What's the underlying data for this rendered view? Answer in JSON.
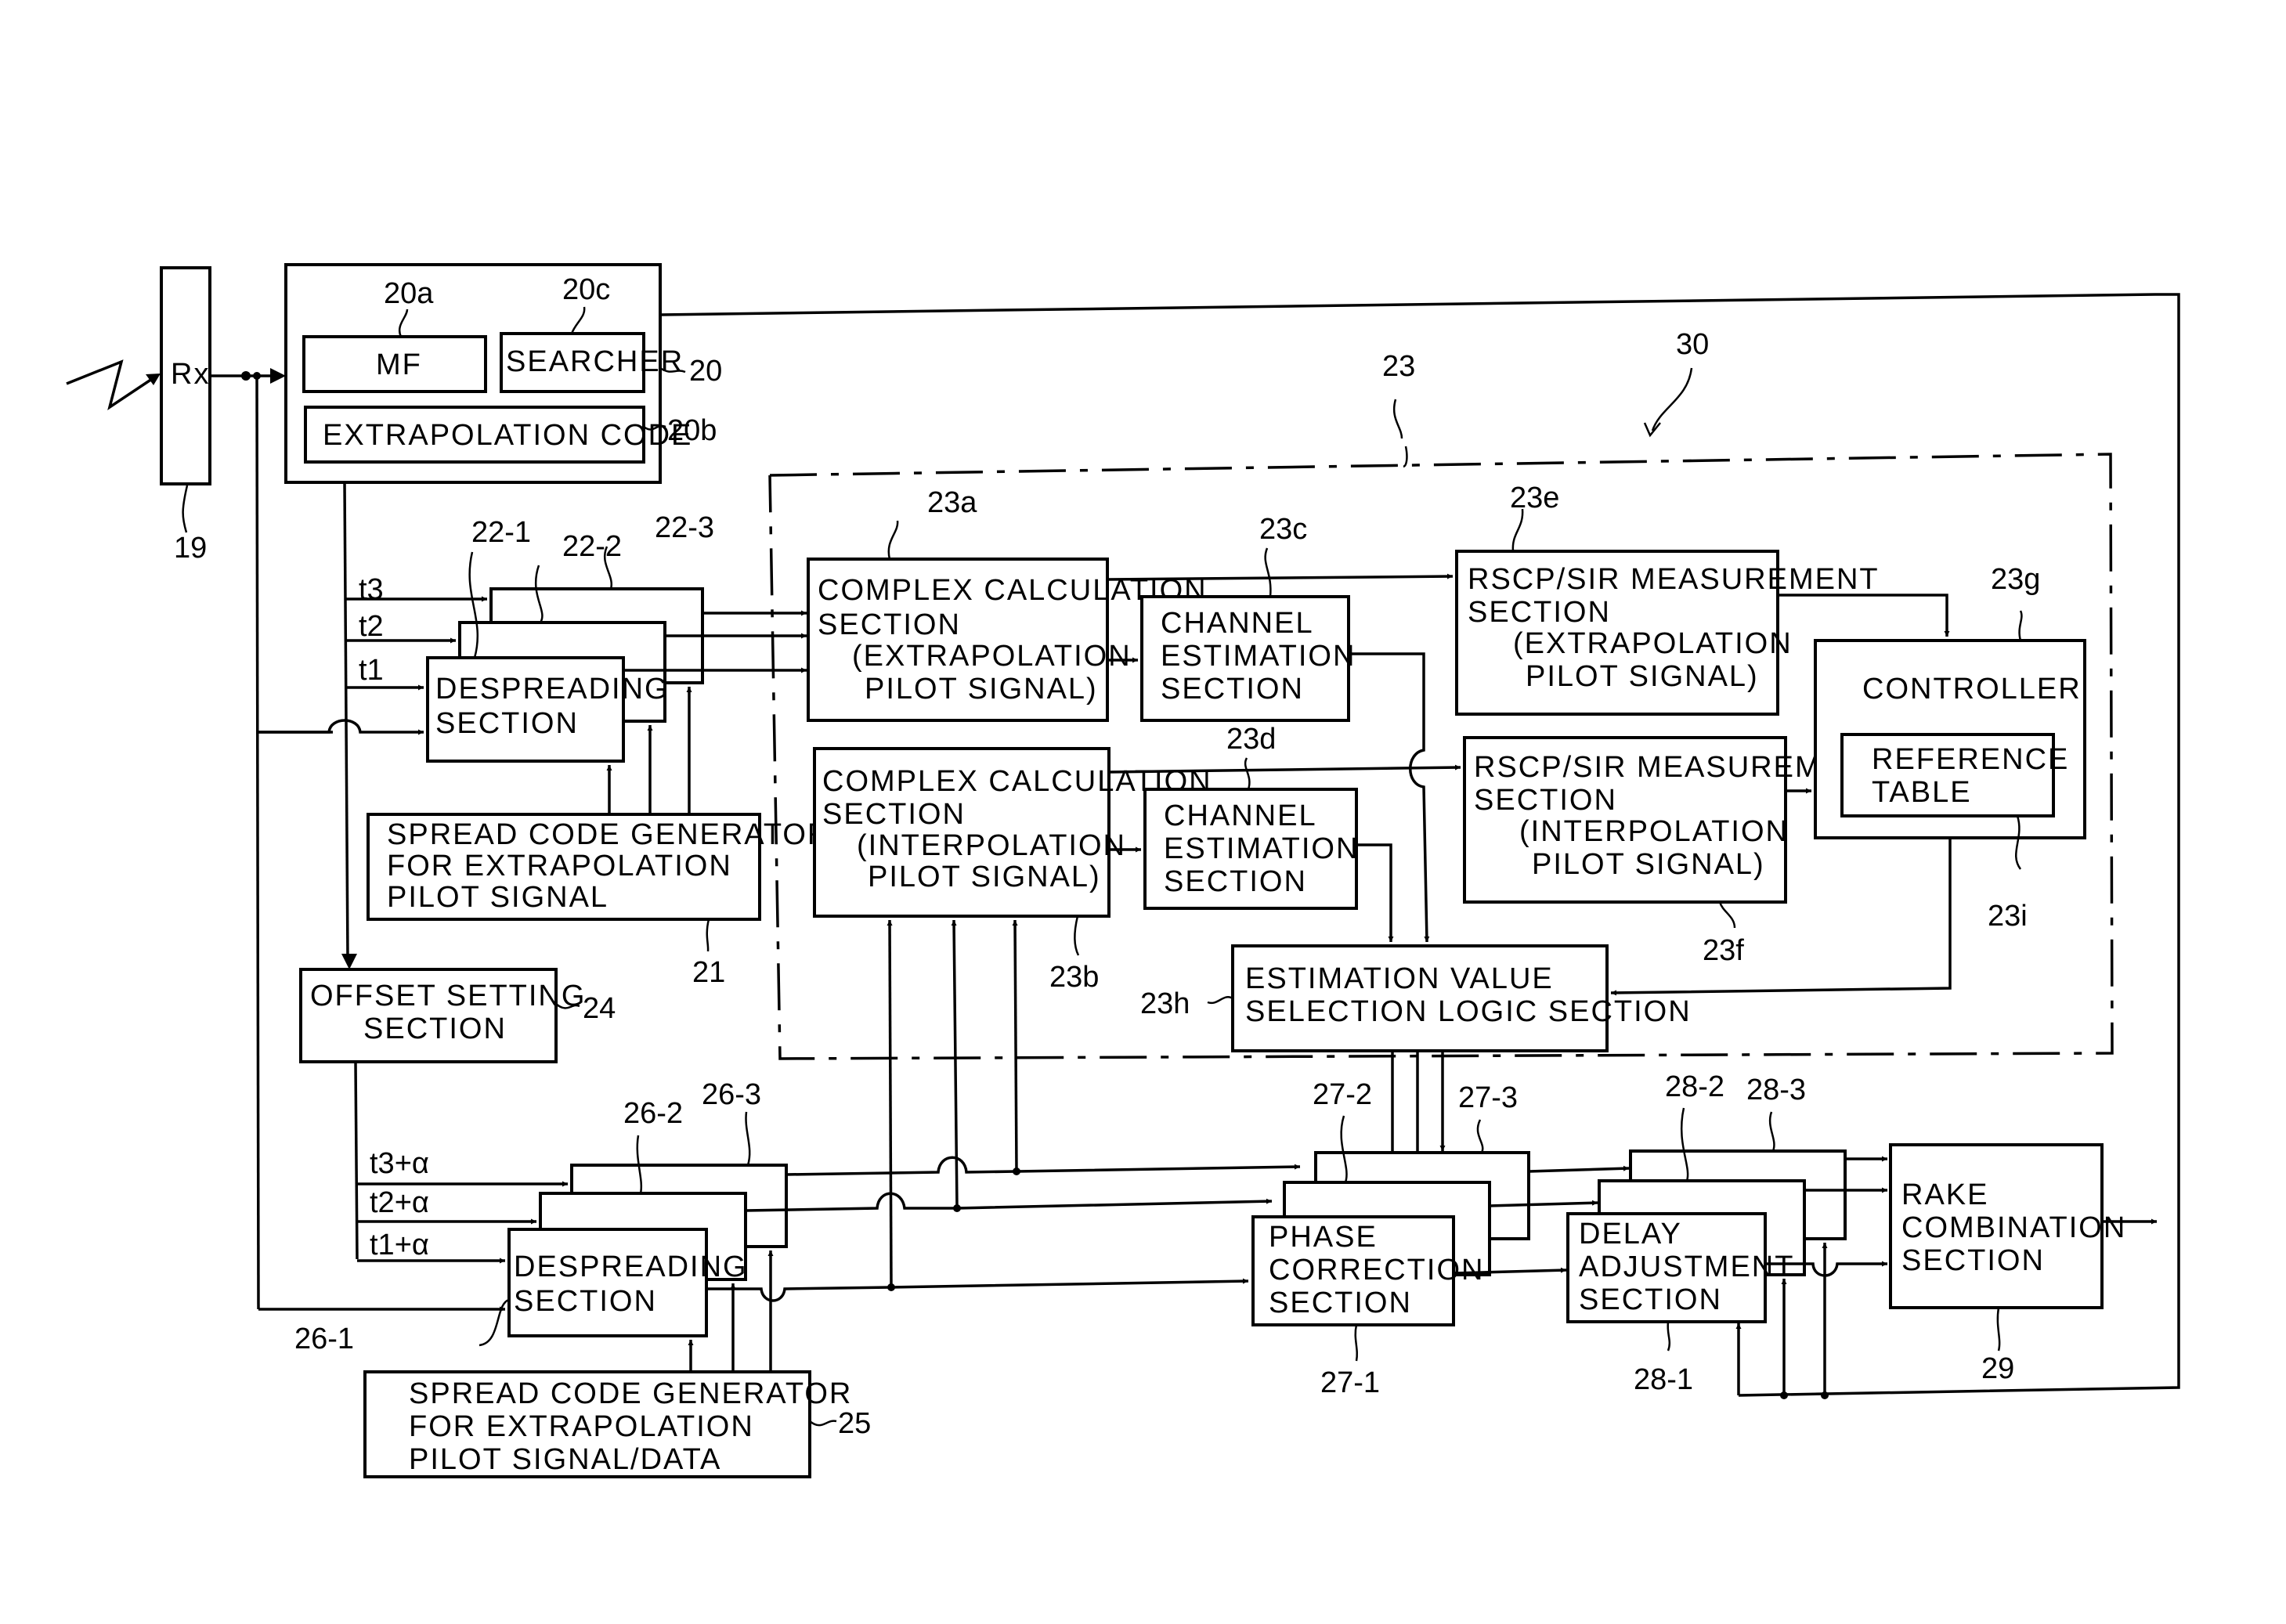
{
  "figure": {
    "system_ref": "30",
    "blocks": {
      "rx": {
        "label": "Rx",
        "ref": "19"
      },
      "block20": {
        "ref": "20"
      },
      "mf": {
        "label": "MF",
        "ref": "20a"
      },
      "searcher": {
        "label": "SEARCHER",
        "ref": "20c"
      },
      "extrapolation_code": {
        "label": "EXTRAPOLATION CODE",
        "ref": "20b"
      },
      "despreading_22": {
        "lines": [
          "DESPREADING",
          "SECTION"
        ],
        "refs": [
          "22-1",
          "22-2",
          "22-3"
        ]
      },
      "spread_code_gen_21": {
        "lines": [
          "SPREAD CODE GENERATOR",
          "FOR EXTRAPOLATION",
          "PILOT SIGNAL"
        ],
        "ref": "21"
      },
      "offset_setting": {
        "lines": [
          "OFFSET SETTING",
          "SECTION"
        ],
        "ref": "24"
      },
      "group23": {
        "ref": "23"
      },
      "complex_calc_extra": {
        "lines": [
          "COMPLEX CALCULATION",
          "SECTION",
          "(EXTRAPOLATION",
          "PILOT SIGNAL)"
        ],
        "ref": "23a"
      },
      "complex_calc_inter": {
        "lines": [
          "COMPLEX CALCULATION",
          "SECTION",
          "(INTERPOLATION",
          "PILOT SIGNAL)"
        ],
        "ref": "23b"
      },
      "channel_est_c": {
        "lines": [
          "CHANNEL",
          "ESTIMATION",
          "SECTION"
        ],
        "ref": "23c"
      },
      "channel_est_d": {
        "lines": [
          "CHANNEL",
          "ESTIMATION",
          "SECTION"
        ],
        "ref": "23d"
      },
      "rscp_extra": {
        "lines": [
          "RSCP/SIR MEASUREMENT",
          "SECTION",
          "(EXTRAPOLATION",
          "PILOT SIGNAL)"
        ],
        "ref": "23e"
      },
      "rscp_inter": {
        "lines": [
          "RSCP/SIR MEASUREMENT",
          "SECTION",
          "(INTERPOLATION",
          "PILOT SIGNAL)"
        ],
        "ref": "23f"
      },
      "controller": {
        "label": "CONTROLLER",
        "ref": "23g"
      },
      "reference_table": {
        "lines": [
          "REFERENCE",
          "TABLE"
        ],
        "ref": "23i"
      },
      "estimation_value": {
        "lines": [
          "ESTIMATION VALUE",
          "SELECTION LOGIC SECTION"
        ],
        "ref": "23h"
      },
      "despreading_26": {
        "lines": [
          "DESPREADING",
          "SECTION"
        ],
        "refs": [
          "26-1",
          "26-2",
          "26-3"
        ]
      },
      "spread_code_gen_25": {
        "lines": [
          "SPREAD CODE GENERATOR",
          "FOR EXTRAPOLATION",
          "PILOT SIGNAL/DATA"
        ],
        "ref": "25"
      },
      "phase_correction": {
        "lines": [
          "PHASE",
          "CORRECTION",
          "SECTION"
        ],
        "refs": [
          "27-1",
          "27-2",
          "27-3"
        ]
      },
      "delay_adjustment": {
        "lines": [
          "DELAY",
          "ADJUSTMENT",
          "SECTION"
        ],
        "refs": [
          "28-1",
          "28-2",
          "28-3"
        ]
      },
      "rake_combination": {
        "lines": [
          "RAKE",
          "COMBINATION",
          "SECTION"
        ],
        "ref": "29"
      }
    },
    "signals": {
      "t_upper": [
        "t3",
        "t2",
        "t1"
      ],
      "t_lower": [
        "t3+α",
        "t2+α",
        "t1+α"
      ]
    }
  }
}
